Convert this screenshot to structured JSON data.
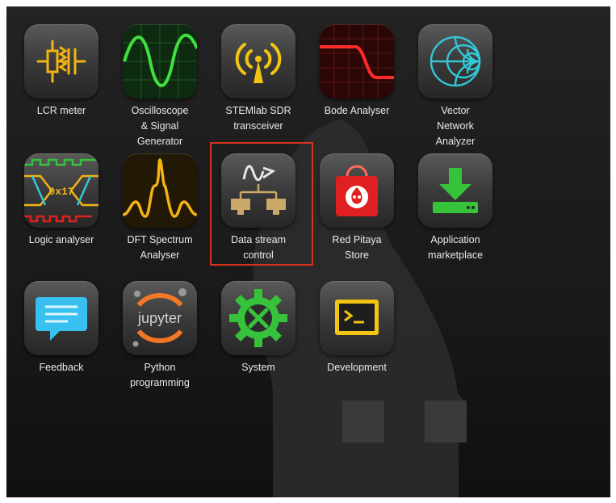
{
  "apps": [
    {
      "label": "LCR meter",
      "icon": "lcr-meter-icon"
    },
    {
      "label": "Oscilloscope\n& Signal\nGenerator",
      "icon": "oscilloscope-icon"
    },
    {
      "label": "STEMlab SDR\ntransceiver",
      "icon": "antenna-icon"
    },
    {
      "label": "Bode Analyser",
      "icon": "bode-plot-icon"
    },
    {
      "label": "Vector\nNetwork\nAnalyzer",
      "icon": "smith-chart-icon"
    },
    {
      "label": "Logic analyser",
      "icon": "logic-analyser-icon",
      "badge": "0x17"
    },
    {
      "label": "DFT Spectrum\nAnalyser",
      "icon": "spectrum-icon"
    },
    {
      "label": "Data stream\ncontrol",
      "icon": "data-stream-icon",
      "selected": true
    },
    {
      "label": "Red Pitaya\nStore",
      "icon": "store-bag-icon"
    },
    {
      "label": "Application\nmarketplace",
      "icon": "download-icon"
    },
    {
      "label": "Feedback",
      "icon": "chat-bubble-icon"
    },
    {
      "label": "Python\nprogramming",
      "icon": "jupyter-icon",
      "logo_text": "jupyter"
    },
    {
      "label": "System",
      "icon": "gear-tools-icon"
    },
    {
      "label": "Development",
      "icon": "terminal-icon"
    }
  ],
  "colors": {
    "highlight": "#d8321d",
    "oscilloscope": "#3fe03f",
    "bode": "#ff2a2a",
    "vna": "#32c8d8",
    "amber": "#f2b413",
    "green": "#36c23a",
    "red": "#e02020",
    "feedback": "#37c0f0"
  }
}
